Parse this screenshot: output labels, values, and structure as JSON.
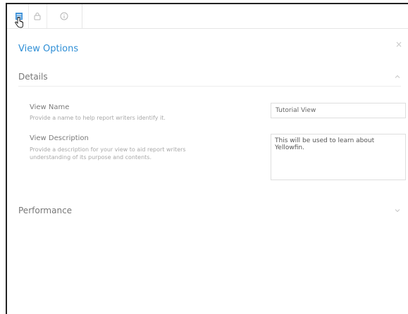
{
  "tabs": [
    {
      "icon": "view-options-icon",
      "active": true
    },
    {
      "icon": "lock-icon",
      "active": false
    },
    {
      "icon": "info-icon",
      "active": false
    }
  ],
  "panel": {
    "title": "View Options",
    "close_label": "×"
  },
  "details": {
    "heading": "Details",
    "view_name": {
      "label": "View Name",
      "help": "Provide a name to help report writers identify it.",
      "value": "Tutorial View"
    },
    "view_description": {
      "label": "View Description",
      "help_line1": "Provide a description for your view to aid report writers",
      "help_line2": "understanding of its purpose and contents.",
      "value": "This will be used to learn about Yellowfin."
    }
  },
  "performance": {
    "heading": "Performance"
  },
  "colors": {
    "accent": "#2f8fd6",
    "active_tab_icon": "#3a8fd8"
  }
}
